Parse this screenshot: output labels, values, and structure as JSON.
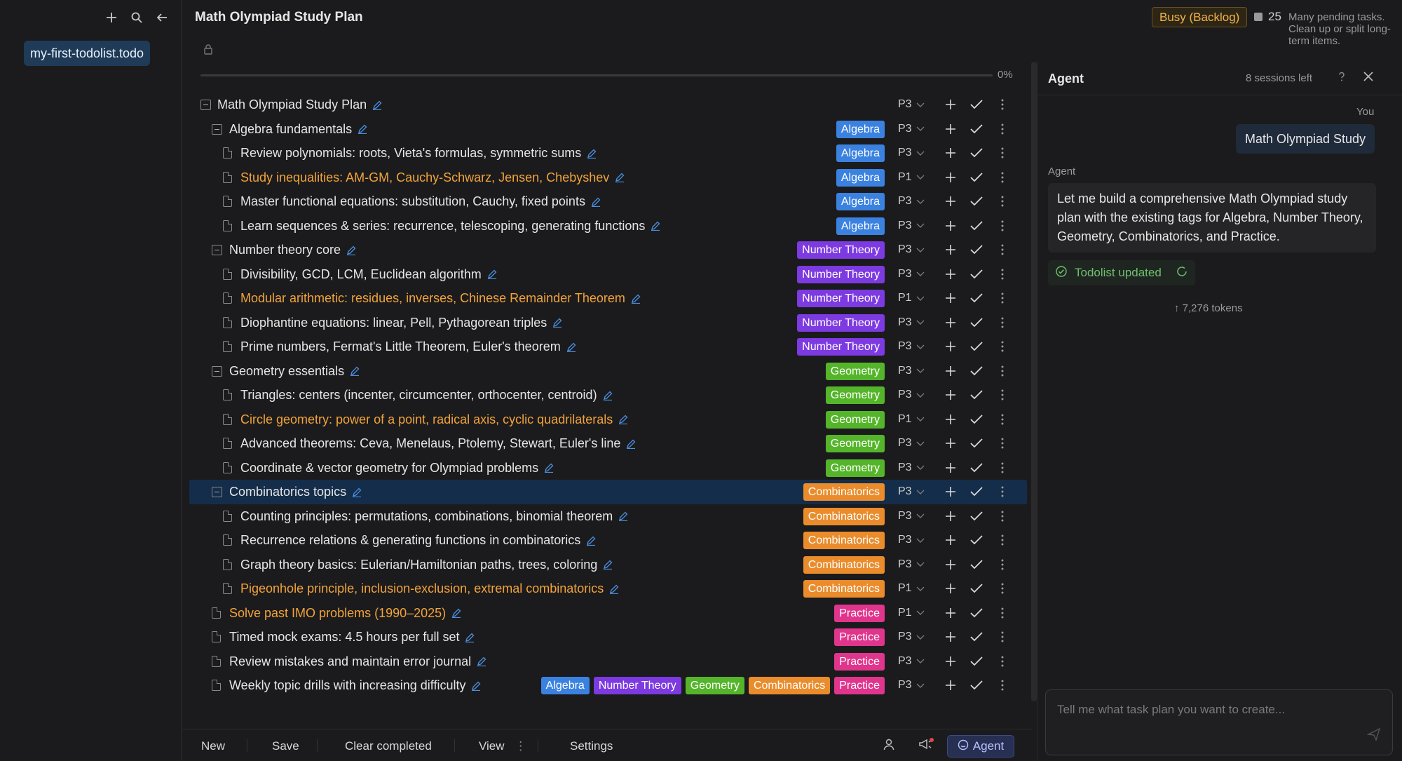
{
  "sidebar": {
    "file": "my-first-todolist.todo"
  },
  "header": {
    "title": "Math Olympiad Study Plan",
    "status_badge": "Busy (Backlog)",
    "pending_count": "25",
    "pending_message": "Many pending tasks. Clean up or split long-term items."
  },
  "progress": {
    "label": "0%",
    "value": 0
  },
  "tasks": [
    {
      "text": "Math Olympiad Study Plan",
      "level": 0,
      "kind": "group",
      "tags": [],
      "priority": "P3",
      "highlight": false
    },
    {
      "text": "Algebra fundamentals",
      "level": 1,
      "kind": "group",
      "tags": [
        "Algebra"
      ],
      "priority": "P3",
      "highlight": false
    },
    {
      "text": "Review polynomials: roots, Vieta's formulas, symmetric sums",
      "level": 2,
      "kind": "item",
      "tags": [
        "Algebra"
      ],
      "priority": "P3",
      "highlight": false
    },
    {
      "text": "Study inequalities: AM-GM, Cauchy-Schwarz, Jensen, Chebyshev",
      "level": 2,
      "kind": "item",
      "tags": [
        "Algebra"
      ],
      "priority": "P1",
      "highlight": true
    },
    {
      "text": "Master functional equations: substitution, Cauchy, fixed points",
      "level": 2,
      "kind": "item",
      "tags": [
        "Algebra"
      ],
      "priority": "P3",
      "highlight": false
    },
    {
      "text": "Learn sequences & series: recurrence, telescoping, generating functions",
      "level": 2,
      "kind": "item",
      "tags": [
        "Algebra"
      ],
      "priority": "P3",
      "highlight": false
    },
    {
      "text": "Number theory core",
      "level": 1,
      "kind": "group",
      "tags": [
        "Number Theory"
      ],
      "priority": "P3",
      "highlight": false
    },
    {
      "text": "Divisibility, GCD, LCM, Euclidean algorithm",
      "level": 2,
      "kind": "item",
      "tags": [
        "Number Theory"
      ],
      "priority": "P3",
      "highlight": false
    },
    {
      "text": "Modular arithmetic: residues, inverses, Chinese Remainder Theorem",
      "level": 2,
      "kind": "item",
      "tags": [
        "Number Theory"
      ],
      "priority": "P1",
      "highlight": true
    },
    {
      "text": "Diophantine equations: linear, Pell, Pythagorean triples",
      "level": 2,
      "kind": "item",
      "tags": [
        "Number Theory"
      ],
      "priority": "P3",
      "highlight": false
    },
    {
      "text": "Prime numbers, Fermat's Little Theorem, Euler's theorem",
      "level": 2,
      "kind": "item",
      "tags": [
        "Number Theory"
      ],
      "priority": "P3",
      "highlight": false
    },
    {
      "text": "Geometry essentials",
      "level": 1,
      "kind": "group",
      "tags": [
        "Geometry"
      ],
      "priority": "P3",
      "highlight": false
    },
    {
      "text": "Triangles: centers (incenter, circumcenter, orthocenter, centroid)",
      "level": 2,
      "kind": "item",
      "tags": [
        "Geometry"
      ],
      "priority": "P3",
      "highlight": false
    },
    {
      "text": "Circle geometry: power of a point, radical axis, cyclic quadrilaterals",
      "level": 2,
      "kind": "item",
      "tags": [
        "Geometry"
      ],
      "priority": "P1",
      "highlight": true
    },
    {
      "text": "Advanced theorems: Ceva, Menelaus, Ptolemy, Stewart, Euler's line",
      "level": 2,
      "kind": "item",
      "tags": [
        "Geometry"
      ],
      "priority": "P3",
      "highlight": false
    },
    {
      "text": "Coordinate & vector geometry for Olympiad problems",
      "level": 2,
      "kind": "item",
      "tags": [
        "Geometry"
      ],
      "priority": "P3",
      "highlight": false
    },
    {
      "text": "Combinatorics topics",
      "level": 1,
      "kind": "group",
      "tags": [
        "Combinatorics"
      ],
      "priority": "P3",
      "highlight": false,
      "selected": true
    },
    {
      "text": "Counting principles: permutations, combinations, binomial theorem",
      "level": 2,
      "kind": "item",
      "tags": [
        "Combinatorics"
      ],
      "priority": "P3",
      "highlight": false
    },
    {
      "text": "Recurrence relations & generating functions in combinatorics",
      "level": 2,
      "kind": "item",
      "tags": [
        "Combinatorics"
      ],
      "priority": "P3",
      "highlight": false
    },
    {
      "text": "Graph theory basics: Eulerian/Hamiltonian paths, trees, coloring",
      "level": 2,
      "kind": "item",
      "tags": [
        "Combinatorics"
      ],
      "priority": "P3",
      "highlight": false
    },
    {
      "text": "Pigeonhole principle, inclusion-exclusion, extremal combinatorics",
      "level": 2,
      "kind": "item",
      "tags": [
        "Combinatorics"
      ],
      "priority": "P1",
      "highlight": true
    },
    {
      "text": "Solve past IMO problems (1990–2025)",
      "level": 1,
      "kind": "item",
      "tags": [
        "Practice"
      ],
      "priority": "P1",
      "highlight": true
    },
    {
      "text": "Timed mock exams: 4.5 hours per full set",
      "level": 1,
      "kind": "item",
      "tags": [
        "Practice"
      ],
      "priority": "P3",
      "highlight": false
    },
    {
      "text": "Review mistakes and maintain error journal",
      "level": 1,
      "kind": "item",
      "tags": [
        "Practice"
      ],
      "priority": "P3",
      "highlight": false
    },
    {
      "text": "Weekly topic drills with increasing difficulty",
      "level": 1,
      "kind": "item",
      "tags": [
        "Algebra",
        "Number Theory",
        "Geometry",
        "Combinatorics",
        "Practice"
      ],
      "priority": "P3",
      "highlight": false
    }
  ],
  "tag_colors": {
    "Algebra": "#3b82e0",
    "Number Theory": "#7c3ae0",
    "Geometry": "#55b52a",
    "Combinatorics": "#ea8c2c",
    "Practice": "#e0358c"
  },
  "footer": {
    "new": "New",
    "save": "Save",
    "clear_completed": "Clear completed",
    "view": "View",
    "settings": "Settings",
    "agent": "Agent"
  },
  "agent": {
    "title": "Agent",
    "sessions": "8 sessions left",
    "you_label": "You",
    "user_message": "Math Olympiad Study",
    "agent_label": "Agent",
    "agent_message": "Let me build a comprehensive Math Olympiad study plan with the existing tags for Algebra, Number Theory, Geometry, Combinatorics, and Practice.",
    "tool_status": "Todolist updated",
    "tokens": "↑ 7,276 tokens",
    "input_placeholder": "Tell me what task plan you want to create..."
  }
}
